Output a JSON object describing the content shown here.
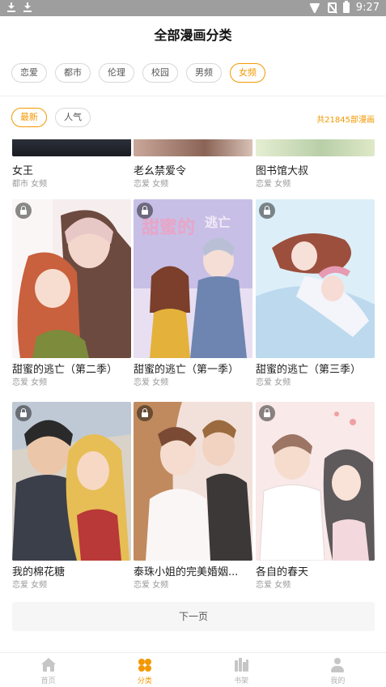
{
  "status_bar": {
    "time": "9:27"
  },
  "header": {
    "title": "全部漫画分类"
  },
  "categories": [
    {
      "label": "恋爱",
      "active": false
    },
    {
      "label": "都市",
      "active": false
    },
    {
      "label": "伦理",
      "active": false
    },
    {
      "label": "校园",
      "active": false
    },
    {
      "label": "男频",
      "active": false
    },
    {
      "label": "女频",
      "active": true
    }
  ],
  "sort": {
    "options": [
      {
        "label": "最新",
        "active": true
      },
      {
        "label": "人气",
        "active": false
      }
    ],
    "total_text": "共21845部漫画"
  },
  "comics": [
    {
      "title": "女王",
      "tags": "都市 女频",
      "locked": false,
      "cover_colors": [
        "#2b2f38",
        "#1a1c22"
      ]
    },
    {
      "title": "老幺禁爱令",
      "tags": "恋爱 女频",
      "locked": false,
      "cover_colors": [
        "#c9a79a",
        "#8a6456"
      ]
    },
    {
      "title": "图书馆大叔",
      "tags": "恋爱 女频",
      "locked": false,
      "cover_colors": [
        "#dfe8c8",
        "#a7c0a0"
      ]
    },
    {
      "title": "甜蜜的逃亡（第二季）",
      "tags": "恋爱 女频",
      "locked": true,
      "cover_colors": [
        "#f2e6e6",
        "#c46a4f"
      ]
    },
    {
      "title": "甜蜜的逃亡（第一季）",
      "tags": "恋爱 女频",
      "locked": true,
      "cover_colors": [
        "#bfb6e0",
        "#6c86b8"
      ]
    },
    {
      "title": "甜蜜的逃亡（第三季）",
      "tags": "恋爱 女频",
      "locked": true,
      "cover_colors": [
        "#d6ecf8",
        "#8fb2d8"
      ]
    },
    {
      "title": "我的棉花糖",
      "tags": "恋爱 女频",
      "locked": true,
      "cover_colors": [
        "#3a3a3a",
        "#e5c05a"
      ]
    },
    {
      "title": "泰珠小姐的完美婚姻...",
      "tags": "恋爱 女频",
      "locked": true,
      "cover_colors": [
        "#e9d3cb",
        "#c7a07c"
      ]
    },
    {
      "title": "各自的春天",
      "tags": "恋爱 女频",
      "locked": true,
      "cover_colors": [
        "#f7e4e4",
        "#6f5b55"
      ]
    }
  ],
  "next_page_label": "下一页",
  "bottom_nav": [
    {
      "label": "首页",
      "icon": "home-icon",
      "active": false
    },
    {
      "label": "分类",
      "icon": "category-icon",
      "active": true
    },
    {
      "label": "书架",
      "icon": "bookshelf-icon",
      "active": false
    },
    {
      "label": "我的",
      "icon": "user-icon",
      "active": false
    }
  ],
  "colors": {
    "accent": "#f39800",
    "muted": "#999999"
  }
}
